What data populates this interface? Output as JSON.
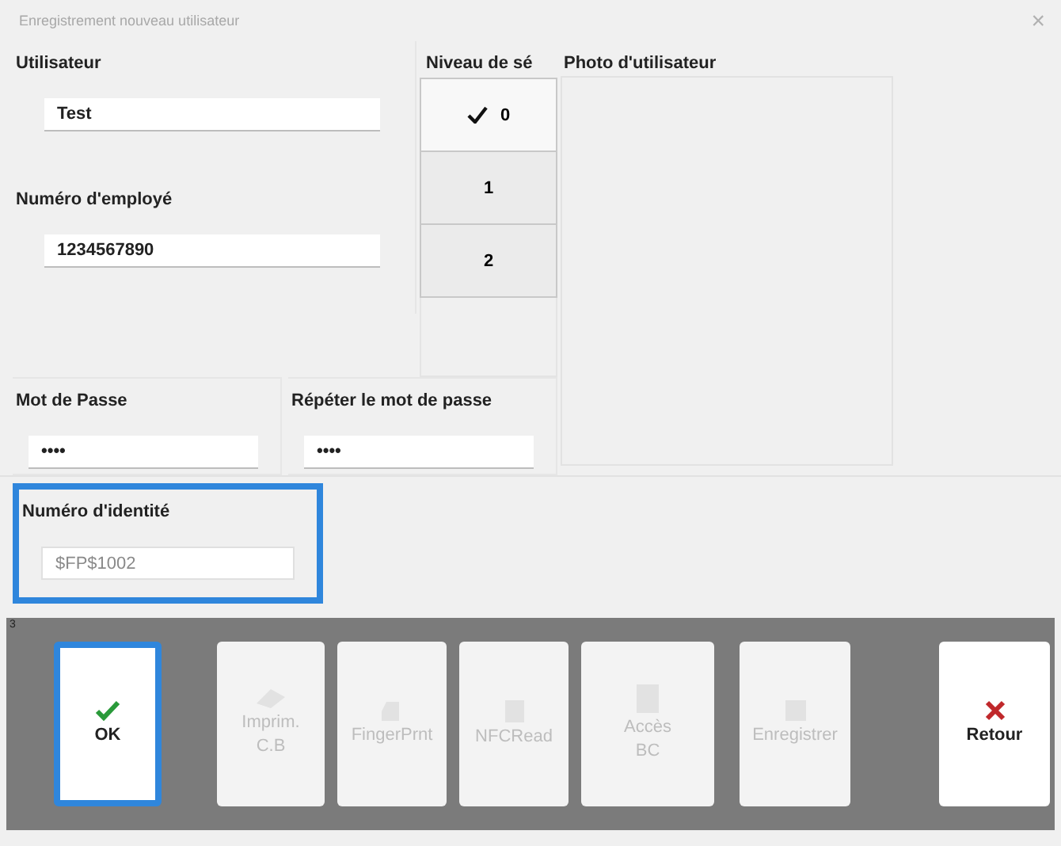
{
  "window": {
    "title": "Enregistrement nouveau utilisateur",
    "close": "×"
  },
  "user_fields": [
    {
      "label": "Utilisateur",
      "value": "Test"
    },
    {
      "label": "Numéro d'employé",
      "value": "1234567890"
    }
  ],
  "security_level": {
    "header": "Niveau de sé",
    "levels": [
      {
        "label": "0",
        "selected": true
      },
      {
        "label": "1",
        "selected": false
      },
      {
        "label": "2",
        "selected": false
      }
    ]
  },
  "photo": {
    "label": "Photo d'utilisateur"
  },
  "password_fields": [
    {
      "label": "Mot de Passe",
      "value": "••••"
    },
    {
      "label": "Répéter le mot de passe",
      "value": "••••"
    }
  ],
  "identity": {
    "label": "Numéro d'identité",
    "value": "$FP$1002",
    "focused": true
  },
  "toolbar": {
    "counter": "3",
    "buttons": [
      {
        "label": "OK",
        "disabled": false,
        "focused": true
      },
      {
        "label": "Imprim.\nC.B",
        "disabled": true,
        "focused": false
      },
      {
        "label": "FingerPrnt",
        "disabled": true,
        "focused": false
      },
      {
        "label": "NFCRead",
        "disabled": true,
        "focused": false
      },
      {
        "label": "Accès\nBC",
        "disabled": true,
        "focused": false
      },
      {
        "label": "Enregistrer",
        "disabled": true,
        "focused": false
      },
      {
        "label": "Retour",
        "disabled": false,
        "focused": false
      }
    ]
  }
}
